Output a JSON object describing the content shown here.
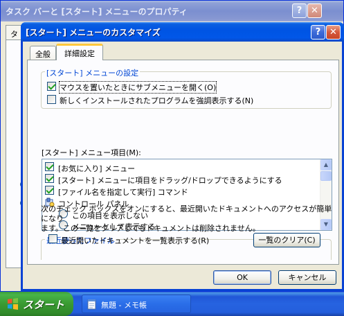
{
  "back_window": {
    "title": "タスク バーと [スタート] メニューのプロパティ",
    "tab_label": "タ",
    "help_label": "?",
    "close_label": "✕"
  },
  "dialog": {
    "title": "[スタート] メニューのカスタマイズ",
    "help_label": "?",
    "close_label": "✕",
    "tabs": [
      {
        "label": "全般",
        "active": false
      },
      {
        "label": "詳細設定",
        "active": true
      }
    ]
  },
  "start_menu_settings": {
    "legend": "[スタート] メニューの設定",
    "options": [
      {
        "label": "マウスを置いたときにサブメニューを開く(O)",
        "checked": true
      },
      {
        "label": "新しくインストールされたプログラムを強調表示する(N)",
        "checked": false
      }
    ]
  },
  "start_menu_items": {
    "label": "[スタート] メニュー項目(M):",
    "items": [
      {
        "type": "checkbox",
        "label": "[お気に入り] メニュー",
        "checked": true
      },
      {
        "type": "checkbox",
        "label": "[スタート] メニューに項目をドラッグ/ドロップできるようにする",
        "checked": true
      },
      {
        "type": "checkbox",
        "label": "[ファイル名を指定して実行] コマンド",
        "checked": true
      },
      {
        "type": "header",
        "label": "コントロール パネル",
        "icon": "control-panel-icon"
      },
      {
        "type": "radio",
        "label": "この項目を表示しない"
      },
      {
        "type": "radio",
        "label": "メニューとして表示する"
      }
    ],
    "scroll_up": "▲",
    "scroll_down": "▼"
  },
  "recent_documents": {
    "legend": "最近使ったファイル",
    "description_line1": "次のチェック ボックスをオンにすると、最近開いたドキュメントへのアクセスが簡単になり",
    "description_line2": "ます。この一覧をクリアしてもドキュメントは削除されません。",
    "list_option": {
      "label": "最近開いたドキュメントを一覧表示する(R)",
      "checked": false
    },
    "clear_button": "一覧のクリア(C)"
  },
  "buttons": {
    "ok": "OK",
    "cancel": "キャンセル"
  },
  "taskbar": {
    "start_label": "スタート",
    "task_label": "無題 - メモ帳"
  },
  "colors": {
    "titlebar_blue": "#0054e3",
    "start_green": "#3a9a32",
    "group_legend": "#0046d5",
    "check_green": "#21a121",
    "tab_highlight": "#ffc83c"
  }
}
